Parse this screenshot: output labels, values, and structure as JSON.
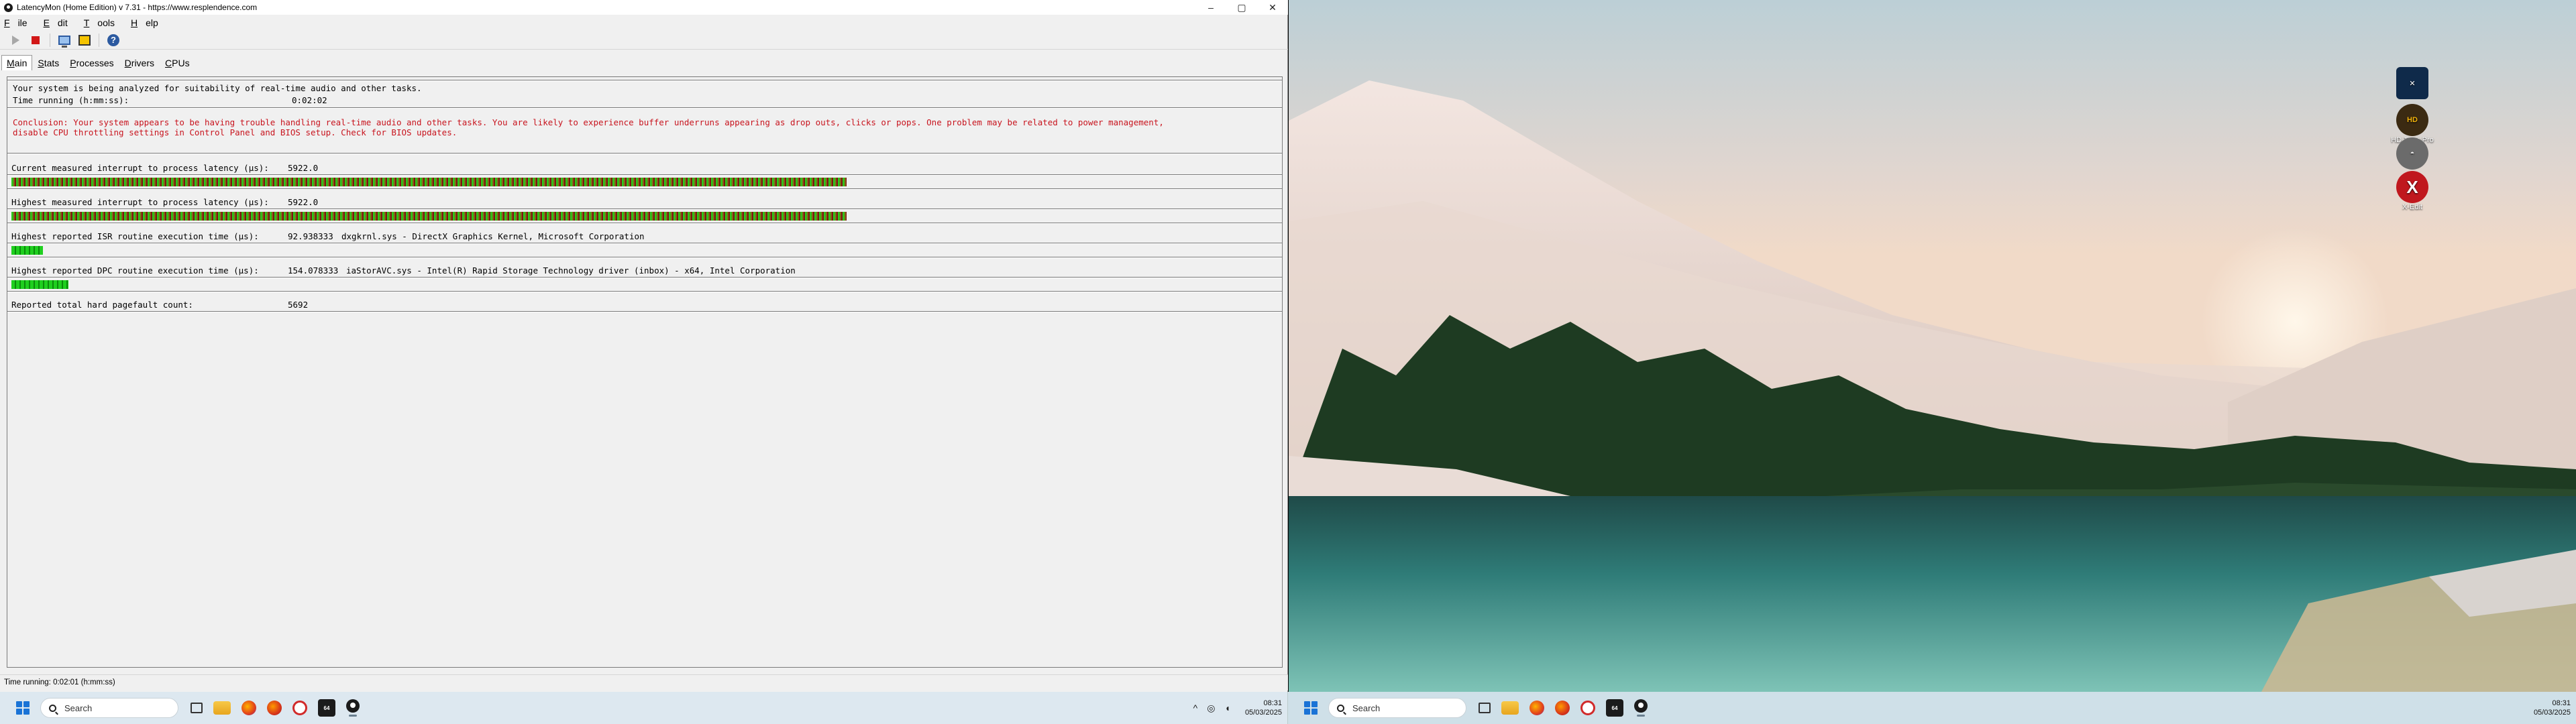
{
  "window": {
    "title": "LatencyMon  (Home Edition)  v 7.31 - https://www.resplendence.com",
    "controls": {
      "minimize": "–",
      "maximize": "▢",
      "close": "✕"
    }
  },
  "menu": {
    "items": [
      {
        "first": "F",
        "rest": "ile"
      },
      {
        "first": "E",
        "rest": "dit"
      },
      {
        "first": "T",
        "rest": "ools"
      },
      {
        "first": "H",
        "rest": "elp"
      }
    ]
  },
  "toolbar": {
    "buttons": [
      "play-icon",
      "stop-icon",
      "monitor-icon",
      "scan-icon",
      "help-icon"
    ],
    "help_glyph": "?"
  },
  "tabs": [
    {
      "first": "M",
      "rest": "ain",
      "active": true
    },
    {
      "first": "S",
      "rest": "tats",
      "active": false
    },
    {
      "first": "P",
      "rest": "rocesses",
      "active": false
    },
    {
      "first": "D",
      "rest": "rivers",
      "active": false
    },
    {
      "first": "C",
      "rest": "PUs",
      "active": false
    }
  ],
  "main": {
    "intro": "Your system is being analyzed for suitability of real-time audio and other tasks.",
    "time_label": "Time running (h:mm:ss):",
    "time_value": "0:02:02",
    "conclusion_line1": "Conclusion: Your system appears to be having trouble handling real-time audio and other tasks. You are likely to experience buffer underruns appearing as drop outs, clicks or pops. One problem may be related to power management,",
    "conclusion_line2": "disable CPU throttling settings in Control Panel and BIOS setup. Check for BIOS updates.",
    "metrics": [
      {
        "label": "Current measured interrupt to process latency (µs):",
        "value": "5922.0",
        "detail": "",
        "level": 0.66
      },
      {
        "label": "Highest measured interrupt to process latency (µs):",
        "value": "5922.0",
        "detail": "",
        "level": 0.66
      },
      {
        "label": "Highest reported ISR routine execution time (µs):",
        "value": "92.938333",
        "detail": "dxgkrnl.sys - DirectX Graphics Kernel, Microsoft Corporation",
        "level": 0.025
      },
      {
        "label": "Highest reported DPC routine execution time (µs):",
        "value": "154.078333",
        "detail": "iaStorAVC.sys - Intel(R) Rapid Storage Technology driver (inbox) - x64, Intel Corporation",
        "level": 0.045
      },
      {
        "label": "Reported total hard pagefault count:",
        "value": "5692",
        "detail": "",
        "level": null
      }
    ]
  },
  "statusbar": {
    "text": "Time running: 0:02:01  (h:mm:ss)"
  },
  "taskbar_left": {
    "search_placeholder": "Search",
    "apps": [
      "task-view-icon",
      "file-explorer-icon",
      "firefox-icon",
      "firefox-icon",
      "disc-icon",
      "aida64-icon",
      "latencymon-icon"
    ],
    "aida_text": "64",
    "tray": {
      "chevron": "^",
      "clock_time": "08:31",
      "clock_date": "05/03/2025"
    }
  },
  "taskbar_right": {
    "search_placeholder": "Search",
    "clock_time": "08:31",
    "clock_date": "05/03/2025"
  },
  "desktop": {
    "icons": [
      {
        "name": "crossover-icon",
        "label": "",
        "glyph": "✕",
        "bg": "#0f2a4a"
      },
      {
        "name": "hd-tune-icon",
        "label": "HD Tune Pro",
        "glyph": "HD",
        "bg": "#3b2a12"
      },
      {
        "name": "helmet-icon",
        "label": "",
        "glyph": "◓",
        "bg": "#6b6b6b"
      },
      {
        "name": "xedit-icon",
        "label": "X-Edit",
        "glyph": "X",
        "bg": "#c0181e"
      }
    ]
  }
}
